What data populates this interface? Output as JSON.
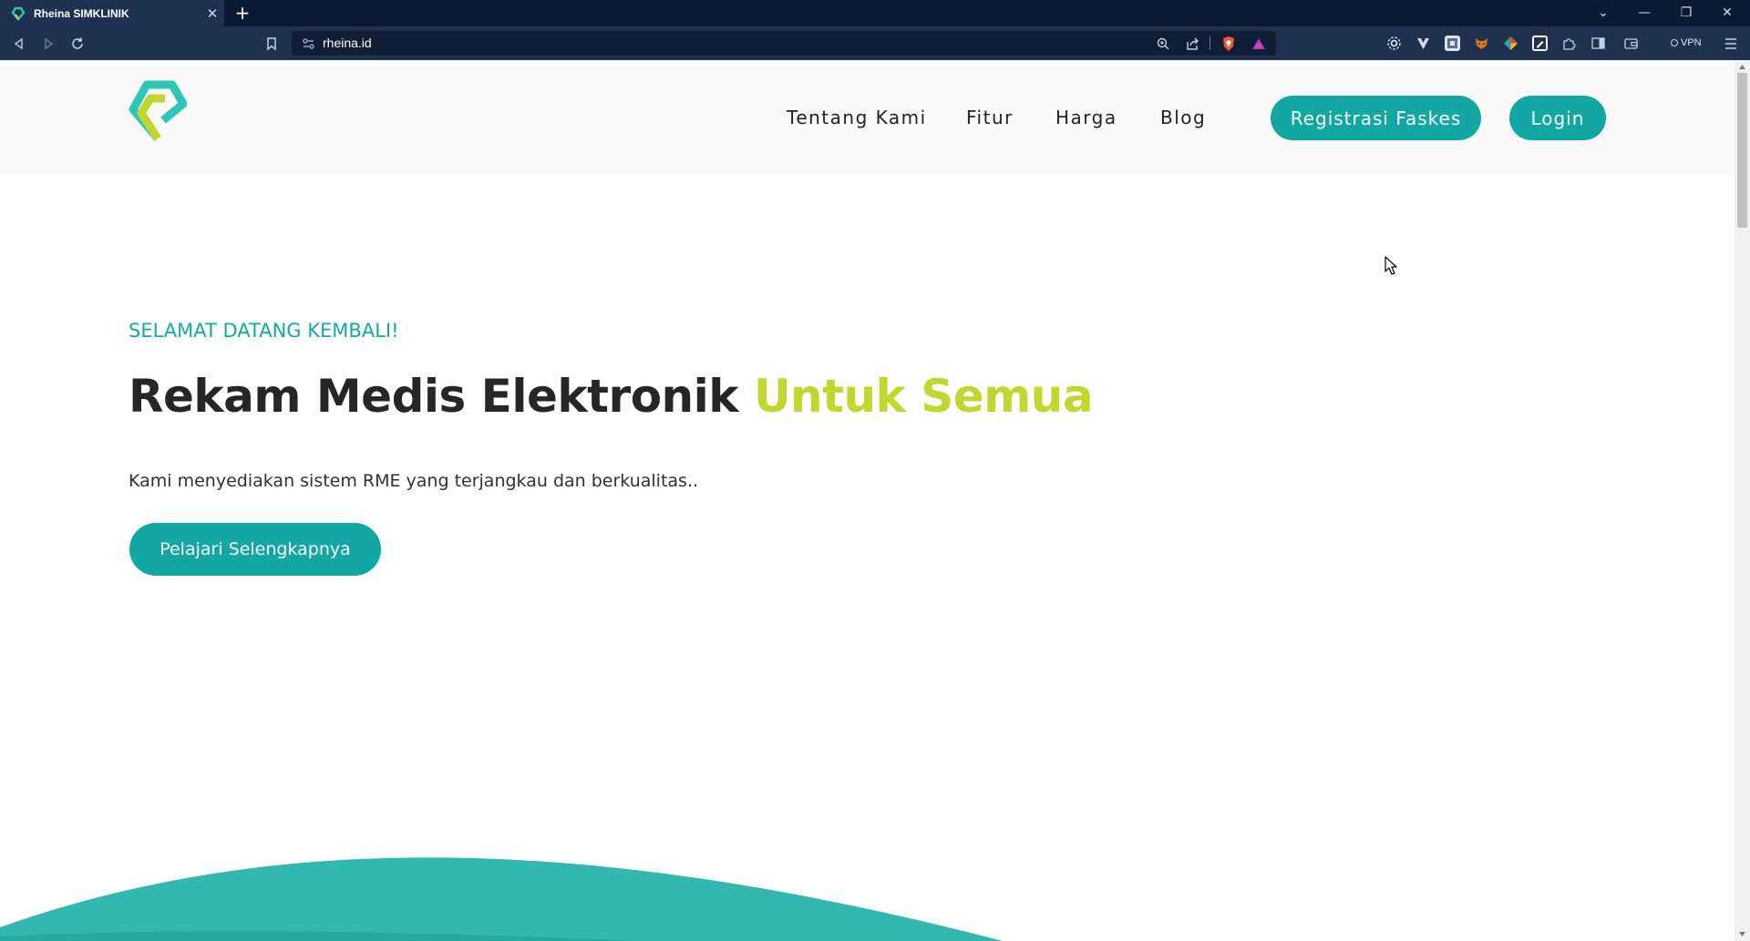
{
  "browser": {
    "tab_title": "Rheina SIMKLINIK",
    "tab_close": "✕",
    "new_tab": "+",
    "url": "rheina.id",
    "vpn_label": "VPN",
    "window_controls": [
      "⌄",
      "—",
      "❐",
      "✕"
    ]
  },
  "site": {
    "nav": [
      "Tentang Kami",
      "Fitur",
      "Harga",
      "Blog"
    ],
    "register_label": "Registrasi Faskes",
    "login_label": "Login"
  },
  "hero": {
    "eyebrow": "SELAMAT DATANG KEMBALI!",
    "headline_main": "Rekam Medis Elektronik ",
    "headline_accent": "Untuk Semua",
    "lead": "Kami menyediakan sistem RME yang terjangkau dan berkualitas..",
    "cta_label": "Pelajari Selengkapnya"
  },
  "colors": {
    "brand_teal": "#12a7a3",
    "accent_lime": "#c2d630",
    "browser_dark": "#0b1a33"
  },
  "icons": [
    "rheina-favicon",
    "back-icon",
    "forward-icon",
    "reload-icon",
    "bookmark-icon",
    "site-info-icon",
    "zoom-icon",
    "share-icon",
    "brave-shields-icon",
    "brave-rewards-icon",
    "sidebar-icon",
    "wallet-icon",
    "menu-icon"
  ]
}
